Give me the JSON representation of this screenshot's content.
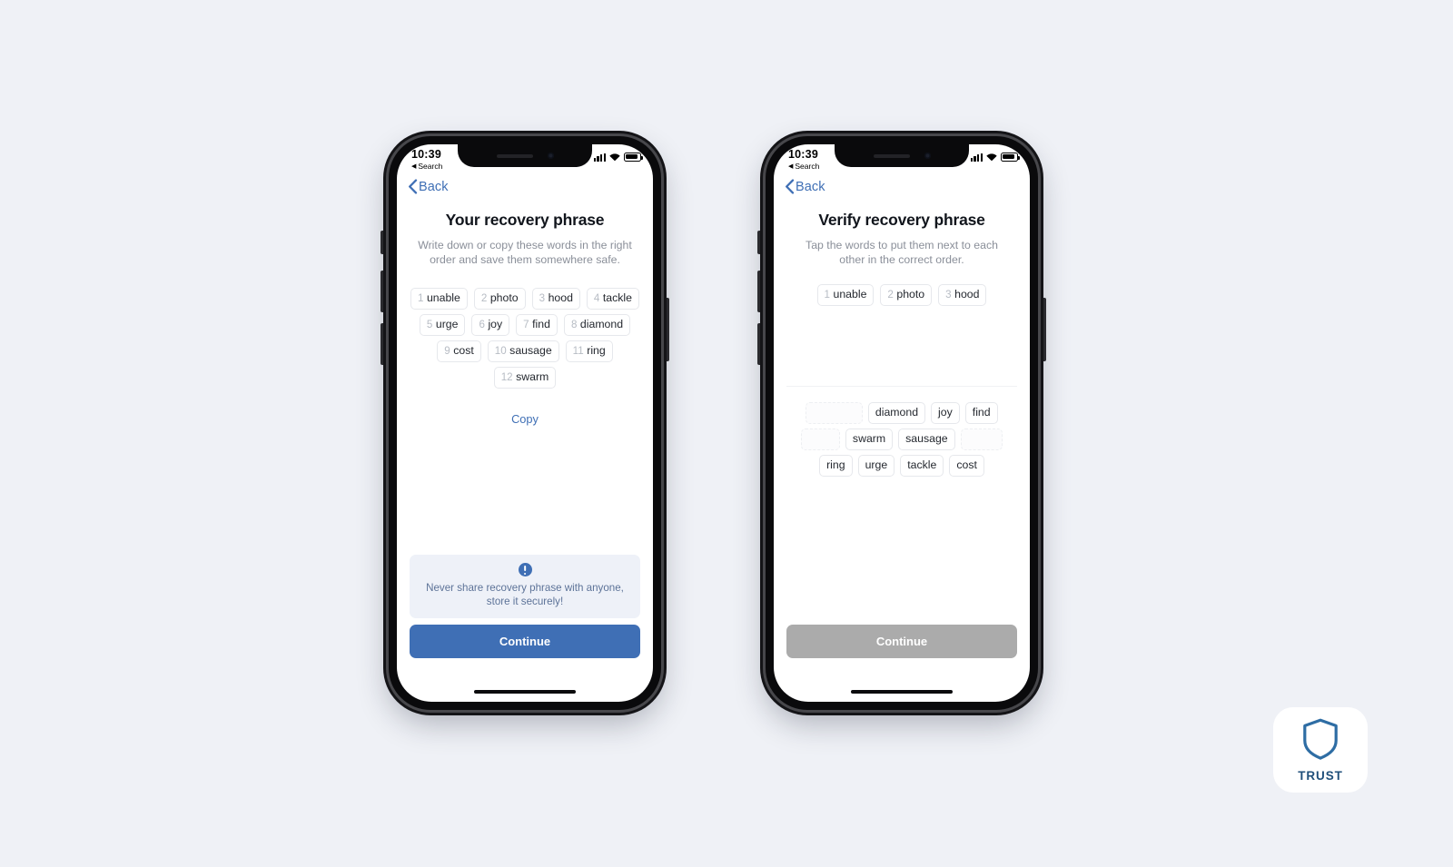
{
  "page": {
    "background_color": "#eff1f6",
    "accent_color": "#3f6fb5",
    "disabled_color": "#ababab"
  },
  "status_bar": {
    "time": "10:39",
    "back_app_label": "Search",
    "back_app_arrow": "◀",
    "signal_icon": "cellular-signal-icon",
    "wifi_icon": "wifi-icon",
    "battery_icon": "battery-icon"
  },
  "phone_1": {
    "nav": {
      "back_label": "Back",
      "back_icon": "chevron-left-icon"
    },
    "title": "Your recovery phrase",
    "subtitle": "Write down or copy these words in the right order and save them somewhere safe.",
    "words": [
      {
        "index": "1",
        "word": "unable"
      },
      {
        "index": "2",
        "word": "photo"
      },
      {
        "index": "3",
        "word": "hood"
      },
      {
        "index": "4",
        "word": "tackle"
      },
      {
        "index": "5",
        "word": "urge"
      },
      {
        "index": "6",
        "word": "joy"
      },
      {
        "index": "7",
        "word": "find"
      },
      {
        "index": "8",
        "word": "diamond"
      },
      {
        "index": "9",
        "word": "cost"
      },
      {
        "index": "10",
        "word": "sausage"
      },
      {
        "index": "11",
        "word": "ring"
      },
      {
        "index": "12",
        "word": "swarm"
      }
    ],
    "copy_label": "Copy",
    "warning": {
      "icon": "exclamation-circle-icon",
      "text": "Never share recovery phrase with anyone, store it securely!"
    },
    "cta_label": "Continue",
    "cta_enabled": true
  },
  "phone_2": {
    "nav": {
      "back_label": "Back",
      "back_icon": "chevron-left-icon"
    },
    "title": "Verify recovery phrase",
    "subtitle": "Tap the words to put them next to each other in the correct order.",
    "selected_words": [
      {
        "index": "1",
        "word": "unable"
      },
      {
        "index": "2",
        "word": "photo"
      },
      {
        "index": "3",
        "word": "hood"
      }
    ],
    "word_bank": [
      {
        "word": "",
        "used": true
      },
      {
        "word": "diamond",
        "used": false
      },
      {
        "word": "joy",
        "used": false
      },
      {
        "word": "find",
        "used": false
      },
      {
        "word": "",
        "used": true
      },
      {
        "word": "swarm",
        "used": false
      },
      {
        "word": "sausage",
        "used": false
      },
      {
        "word": "",
        "used": true
      },
      {
        "word": "ring",
        "used": false
      },
      {
        "word": "urge",
        "used": false
      },
      {
        "word": "tackle",
        "used": false
      },
      {
        "word": "cost",
        "used": false
      }
    ],
    "cta_label": "Continue",
    "cta_enabled": false
  },
  "brand": {
    "name": "TRUST",
    "icon": "shield-icon",
    "color": "#2e6da4"
  }
}
